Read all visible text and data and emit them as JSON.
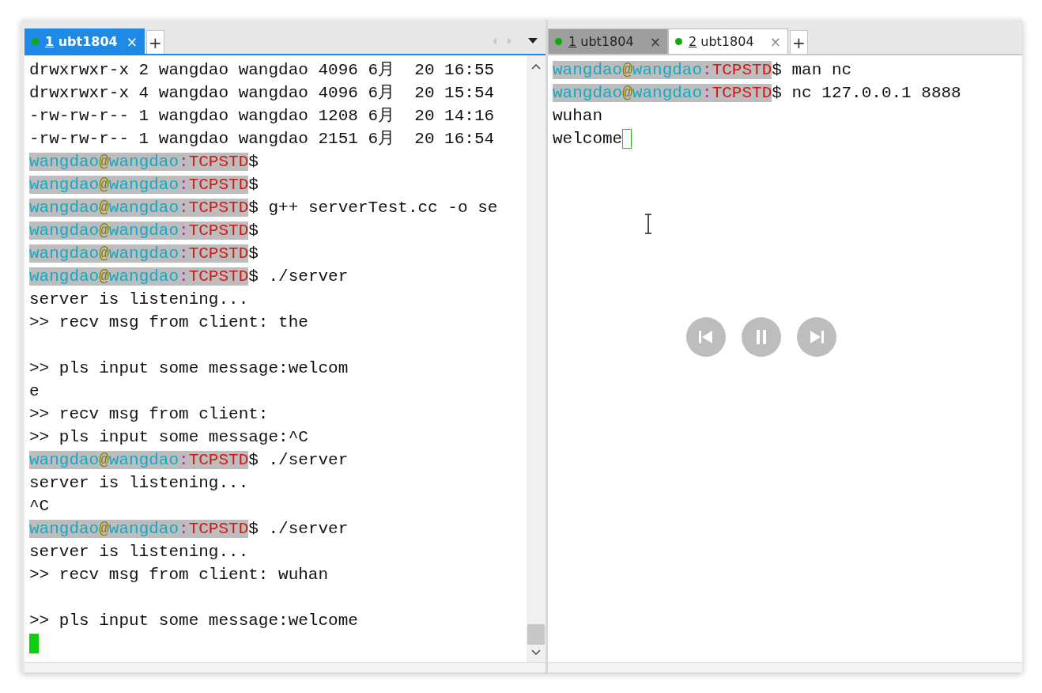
{
  "panes": [
    {
      "tabs": [
        {
          "number": "1",
          "label": "ubt1804",
          "selected": true,
          "close": "×"
        }
      ],
      "add_tab": "+",
      "nav": true,
      "scrollbar": true,
      "lines": [
        {
          "kind": "text",
          "text": "drwxrwxr-x 2 wangdao wangdao 4096 6月  20 16:55"
        },
        {
          "kind": "text",
          "text": "drwxrwxr-x 4 wangdao wangdao 4096 6月  20 15:54"
        },
        {
          "kind": "text",
          "text": "-rw-rw-r-- 1 wangdao wangdao 1208 6月  20 14:16"
        },
        {
          "kind": "text",
          "text": "-rw-rw-r-- 1 wangdao wangdao 2151 6月  20 16:54"
        },
        {
          "kind": "prompt",
          "user": "wangdao",
          "at": "@",
          "host": "wangdao",
          "colon": ":",
          "dir": "TCPSTD",
          "rest": "$"
        },
        {
          "kind": "prompt",
          "user": "wangdao",
          "at": "@",
          "host": "wangdao",
          "colon": ":",
          "dir": "TCPSTD",
          "rest": "$"
        },
        {
          "kind": "prompt",
          "user": "wangdao",
          "at": "@",
          "host": "wangdao",
          "colon": ":",
          "dir": "TCPSTD",
          "rest": "$ g++ serverTest.cc -o se"
        },
        {
          "kind": "prompt",
          "user": "wangdao",
          "at": "@",
          "host": "wangdao",
          "colon": ":",
          "dir": "TCPSTD",
          "rest": "$"
        },
        {
          "kind": "prompt",
          "user": "wangdao",
          "at": "@",
          "host": "wangdao",
          "colon": ":",
          "dir": "TCPSTD",
          "rest": "$"
        },
        {
          "kind": "prompt",
          "user": "wangdao",
          "at": "@",
          "host": "wangdao",
          "colon": ":",
          "dir": "TCPSTD",
          "rest": "$ ./server"
        },
        {
          "kind": "text",
          "text": "server is listening..."
        },
        {
          "kind": "text",
          "text": ">> recv msg from client: the"
        },
        {
          "kind": "blank"
        },
        {
          "kind": "text",
          "text": ">> pls input some message:welcom"
        },
        {
          "kind": "text",
          "text": "e"
        },
        {
          "kind": "text",
          "text": ">> recv msg from client:"
        },
        {
          "kind": "text",
          "text": ">> pls input some message:^C"
        },
        {
          "kind": "prompt",
          "user": "wangdao",
          "at": "@",
          "host": "wangdao",
          "colon": ":",
          "dir": "TCPSTD",
          "rest": "$ ./server"
        },
        {
          "kind": "text",
          "text": "server is listening..."
        },
        {
          "kind": "text",
          "text": "^C"
        },
        {
          "kind": "prompt",
          "user": "wangdao",
          "at": "@",
          "host": "wangdao",
          "colon": ":",
          "dir": "TCPSTD",
          "rest": "$ ./server"
        },
        {
          "kind": "text",
          "text": "server is listening..."
        },
        {
          "kind": "text",
          "text": ">> recv msg from client: wuhan"
        },
        {
          "kind": "blank"
        },
        {
          "kind": "text",
          "text": ">> pls input some message:welcome"
        },
        {
          "kind": "cursor",
          "filled": true
        }
      ]
    },
    {
      "tabs": [
        {
          "number": "1",
          "label": "ubt1804",
          "selected": false,
          "close": "×"
        },
        {
          "number": "2",
          "label": "ubt1804",
          "selected": true,
          "close": "×"
        }
      ],
      "add_tab": "+",
      "media_controls": true,
      "lines": [
        {
          "kind": "prompt",
          "user": "wangdao",
          "at": "@",
          "host": "wangdao",
          "colon": ":",
          "dir": "TCPSTD",
          "rest": "$ man nc"
        },
        {
          "kind": "prompt",
          "user": "wangdao",
          "at": "@",
          "host": "wangdao",
          "colon": ":",
          "dir": "TCPSTD",
          "rest": "$ nc 127.0.0.1 8888"
        },
        {
          "kind": "text",
          "text": "wuhan"
        },
        {
          "kind": "text",
          "text": "welcome",
          "cursor": true,
          "filled": false
        }
      ]
    }
  ]
}
